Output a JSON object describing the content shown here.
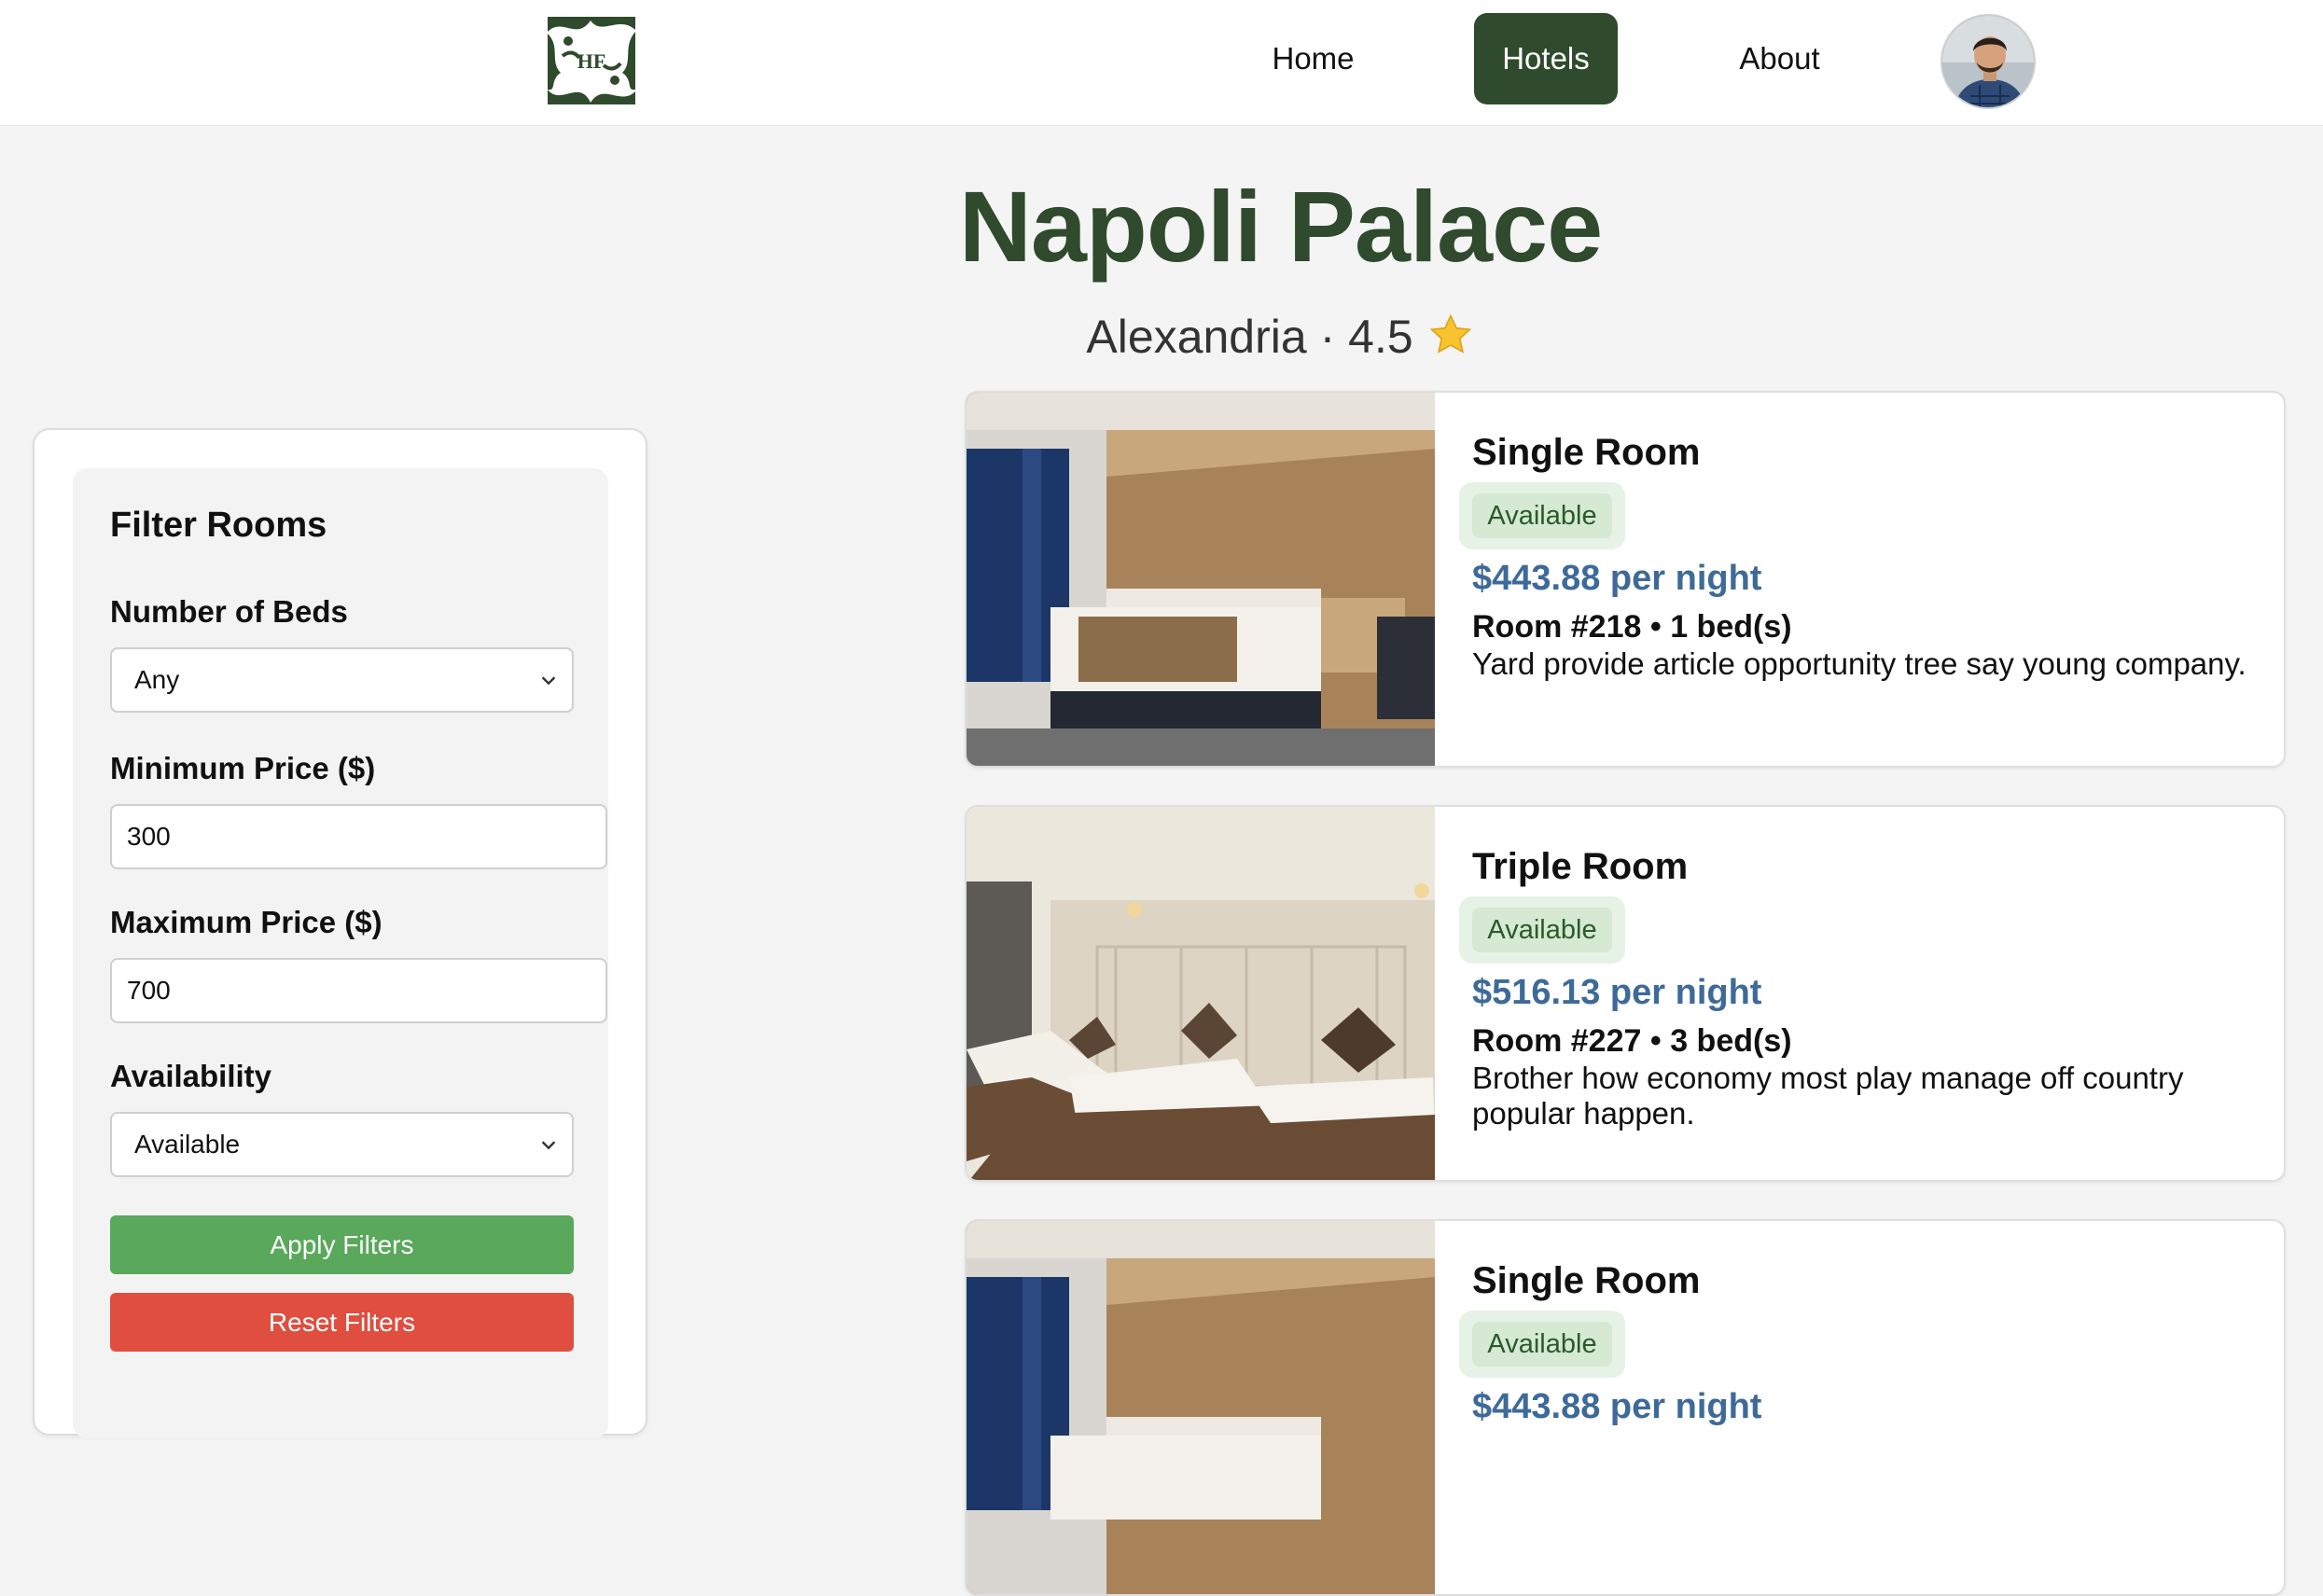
{
  "nav": {
    "logo_text": "HF",
    "items": [
      {
        "label": "Home",
        "active": false
      },
      {
        "label": "Hotels",
        "active": true
      },
      {
        "label": "About",
        "active": false
      }
    ]
  },
  "hotel": {
    "name": "Napoli Palace",
    "city": "Alexandria",
    "separator": "·",
    "rating": "4.5",
    "rating_icon": "star-icon"
  },
  "filters": {
    "title": "Filter Rooms",
    "beds": {
      "label": "Number of Beds",
      "value": "Any"
    },
    "min_price": {
      "label": "Minimum Price ($)",
      "value": "300"
    },
    "max_price": {
      "label": "Maximum Price ($)",
      "value": "700"
    },
    "availability": {
      "label": "Availability",
      "value": "Available"
    },
    "apply_label": "Apply Filters",
    "reset_label": "Reset Filters"
  },
  "rooms": [
    {
      "type": "Single Room",
      "status": "Available",
      "price": "$443.88 per night",
      "meta": "Room #218 • 1 bed(s)",
      "description": "Yard provide article opportunity tree say young company."
    },
    {
      "type": "Triple Room",
      "status": "Available",
      "price": "$516.13 per night",
      "meta": "Room #227 • 3 bed(s)",
      "description": "Brother how economy most play manage off country popular happen."
    },
    {
      "type": "Single Room",
      "status": "Available",
      "price": "$443.88 per night",
      "meta": "",
      "description": ""
    }
  ],
  "colors": {
    "brand_green": "#2f4a2c",
    "price_blue": "#3e6a9a",
    "apply_green": "#5aa85b",
    "reset_red": "#df4e3f",
    "badge_bg": "#d5e9d3"
  }
}
